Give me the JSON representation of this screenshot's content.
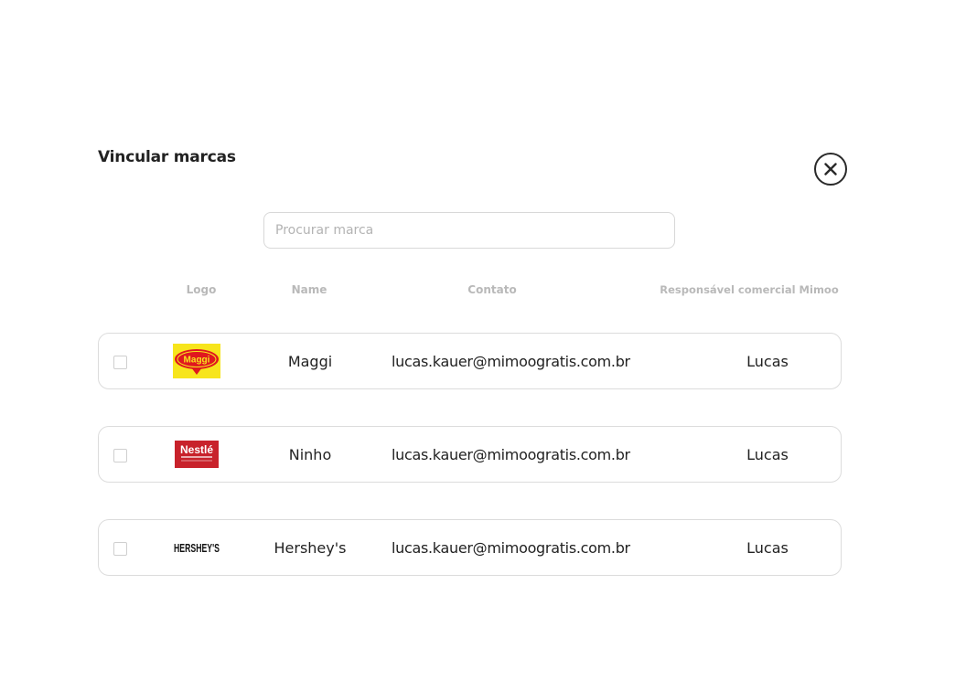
{
  "modal": {
    "title": "Vincular marcas",
    "close_icon": "close-circle-icon"
  },
  "search": {
    "placeholder": "Procurar marca",
    "value": ""
  },
  "table": {
    "headers": {
      "logo": "Logo",
      "name": "Name",
      "contato": "Contato",
      "responsavel": "Responsável comercial Mimoo"
    },
    "rows": [
      {
        "checked": false,
        "logo_text": "Maggi",
        "name": "Maggi",
        "contato": "lucas.kauer@mimoogratis.com.br",
        "responsavel": "Lucas"
      },
      {
        "checked": false,
        "logo_text": "Nestlé",
        "name": "Ninho",
        "contato": "lucas.kauer@mimoogratis.com.br",
        "responsavel": "Lucas"
      },
      {
        "checked": false,
        "logo_text": "HERSHEY'S",
        "name": "Hershey's",
        "contato": "lucas.kauer@mimoogratis.com.br",
        "responsavel": "Lucas"
      }
    ]
  },
  "colors": {
    "maggi_yellow": "#f7e51c",
    "maggi_red": "#e0171f",
    "nestle_red": "#c8222b",
    "hershey_black": "#111111"
  }
}
